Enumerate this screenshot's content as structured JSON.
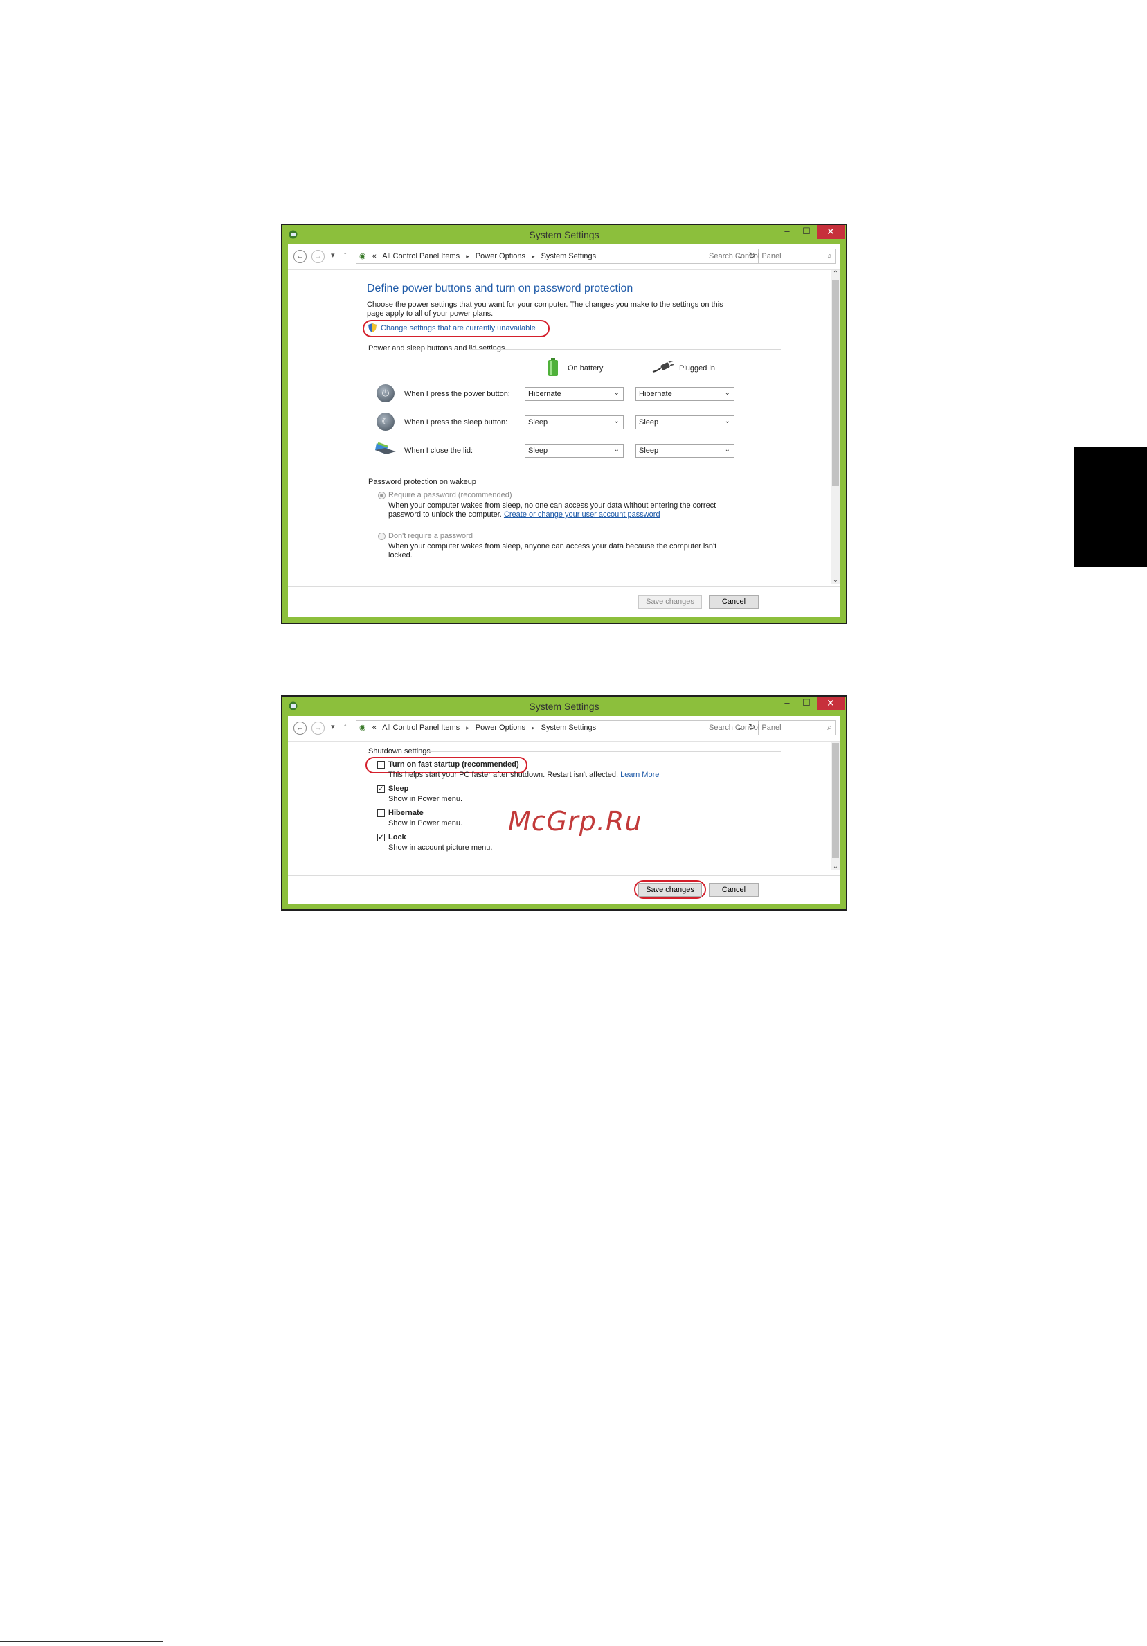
{
  "window_title": "System Settings",
  "window_controls": {
    "minimize": "–",
    "maximize": "☐",
    "close": "✕"
  },
  "address": {
    "overflow": "«",
    "crumbs": [
      "All Control Panel Items",
      "Power Options",
      "System Settings"
    ],
    "search_placeholder": "Search Control Panel"
  },
  "screen1": {
    "heading": "Define power buttons and turn on password protection",
    "intro_line1": "Choose the power settings that you want for your computer. The changes you make to the settings on this",
    "intro_line2": "page apply to all of your power plans.",
    "change_link": "Change settings that are currently unavailable",
    "section_power": "Power and sleep buttons and lid settings",
    "col_battery": "On battery",
    "col_plugged": "Plugged in",
    "rows": [
      {
        "label": "When I press the power button:",
        "battery": "Hibernate",
        "plugged": "Hibernate"
      },
      {
        "label": "When I press the sleep button:",
        "battery": "Sleep",
        "plugged": "Sleep"
      },
      {
        "label": "When I close the lid:",
        "battery": "Sleep",
        "plugged": "Sleep"
      }
    ],
    "section_password": "Password protection on wakeup",
    "require_label": "Require a password (recommended)",
    "require_desc1": "When your computer wakes from sleep, no one can access your data without entering the correct",
    "require_desc2": "password to unlock the computer.",
    "require_link": "Create or change your user account password",
    "norequire_label": "Don't require a password",
    "norequire_desc1": "When your computer wakes from sleep, anyone can access your data because the computer isn't",
    "norequire_desc2": "locked.",
    "save": "Save changes",
    "cancel": "Cancel"
  },
  "screen2": {
    "section_shutdown": "Shutdown settings",
    "items": [
      {
        "label": "Turn on fast startup (recommended)",
        "desc": "This helps start your PC faster after shutdown. Restart isn't affected.",
        "link": "Learn More",
        "checked": false
      },
      {
        "label": "Sleep",
        "desc": "Show in Power menu.",
        "checked": true
      },
      {
        "label": "Hibernate",
        "desc": "Show in Power menu.",
        "checked": false
      },
      {
        "label": "Lock",
        "desc": "Show in account picture menu.",
        "checked": true
      }
    ],
    "save": "Save changes",
    "cancel": "Cancel"
  },
  "watermark": "McGrp.Ru",
  "colors": {
    "title_bar": "#8cbf3c",
    "highlight_oval": "#d4202c",
    "link": "#1e5aa8",
    "close": "#c7303b"
  },
  "icons": [
    "control-panel-icon",
    "back-arrow-icon",
    "forward-arrow-icon",
    "up-arrow-icon",
    "refresh-icon",
    "search-icon",
    "uac-shield-icon",
    "battery-icon",
    "plug-icon",
    "power-button-icon",
    "sleep-button-icon",
    "laptop-lid-icon"
  ]
}
